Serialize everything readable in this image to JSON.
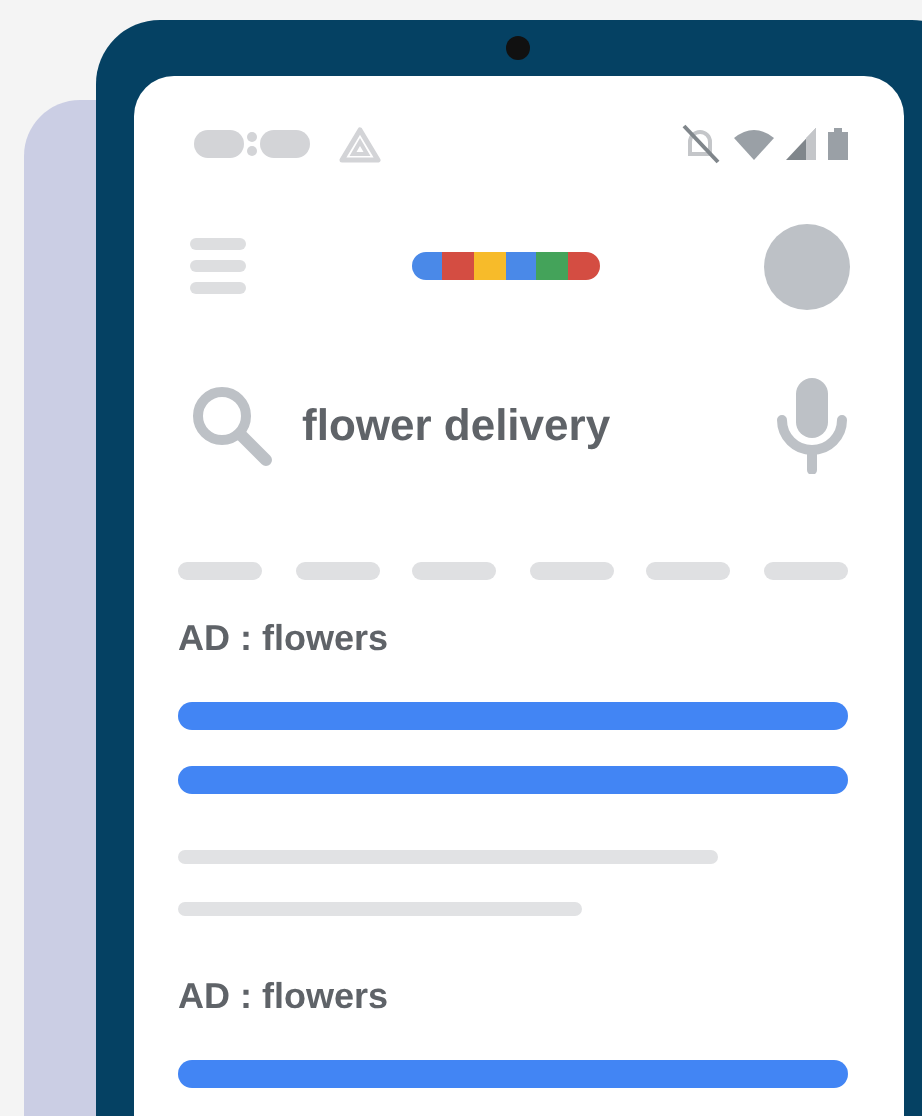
{
  "search": {
    "value": "flower delivery"
  },
  "results": [
    {
      "label": "AD : flowers"
    },
    {
      "label": "AD : flowers"
    }
  ]
}
